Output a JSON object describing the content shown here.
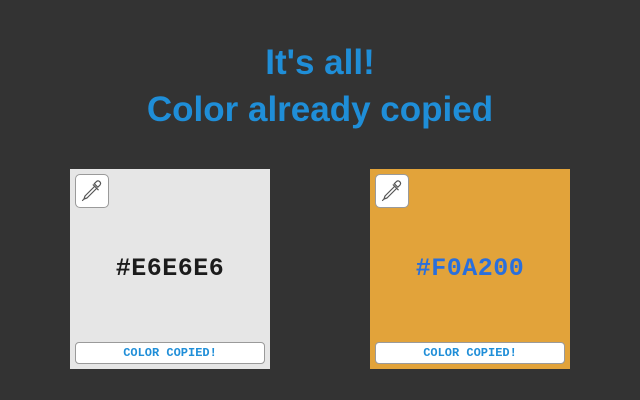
{
  "header": {
    "line1": "It's all!",
    "line2": "Color already copied"
  },
  "colors": {
    "background": "#333333",
    "headline": "#1f8ed8",
    "copied_label": "#1f8ed8"
  },
  "cards": [
    {
      "hex_label": "#E6E6E6",
      "swatch_color": "#E6E6E6",
      "text_color": "#1c1c1c",
      "picker_icon": "eyedropper-icon",
      "copied_label": "COLOR COPIED!"
    },
    {
      "hex_label": "#F0A200",
      "swatch_color": "#E2A33A",
      "text_color": "#2a6fdc",
      "picker_icon": "eyedropper-icon",
      "copied_label": "COLOR COPIED!"
    }
  ]
}
